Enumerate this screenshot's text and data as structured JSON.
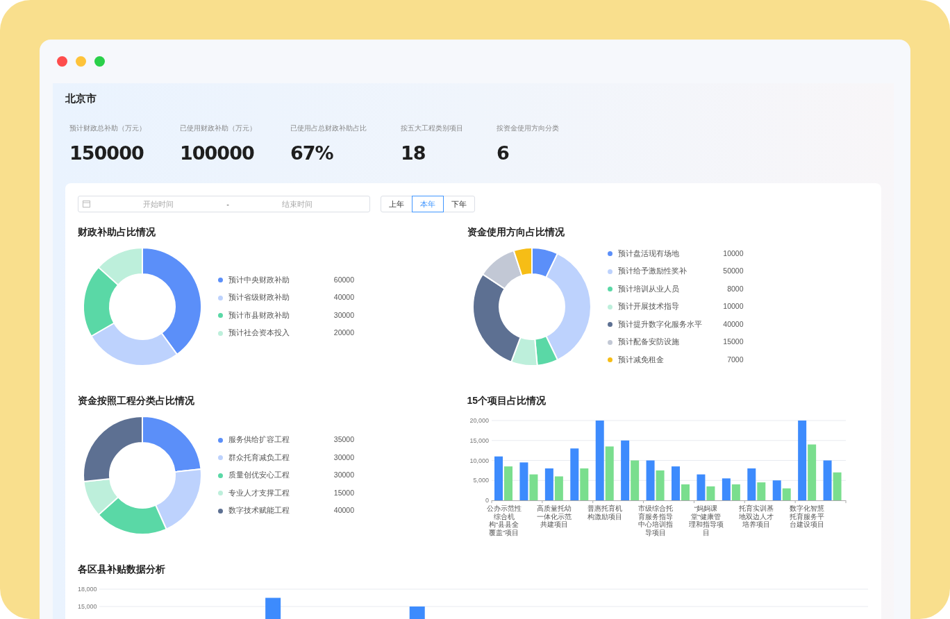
{
  "region": {
    "title": "北京市"
  },
  "stats": [
    {
      "label": "预计财政总补助（万元）",
      "value": "150000"
    },
    {
      "label": "已使用财政补助（万元）",
      "value": "100000"
    },
    {
      "label": "已使用占总财政补助占比",
      "value": "67%"
    },
    {
      "label": "按五大工程类别项目",
      "value": "18"
    },
    {
      "label": "按资金使用方向分类",
      "value": "6"
    }
  ],
  "date_range": {
    "start_placeholder": "开始时间",
    "separator": "-",
    "end_placeholder": "结束时间"
  },
  "year_tabs": [
    {
      "label": "上年",
      "selected": false
    },
    {
      "label": "本年",
      "selected": true
    },
    {
      "label": "下年",
      "selected": false
    }
  ],
  "panels": [
    {
      "title": "财政补助占比情况",
      "legend": [
        {
          "color": "#5b8ff9"
        },
        {
          "color": "#bdd2fd"
        },
        {
          "color": "#5ad8a6"
        },
        {
          "color": "#bdefdb"
        }
      ],
      "chart_data": {
        "type": "donut",
        "legend": "right",
        "value_labels": [
          "60000",
          "40000",
          "30000",
          "20000"
        ],
        "categories": [
          "预计中央财政补助",
          "预计省级财政补助",
          "预计市县财政补助",
          "预计社会资本投入"
        ],
        "values": [
          60000,
          40000,
          30000,
          20000
        ]
      }
    },
    {
      "title": "资金使用方向占比情况",
      "legend": [
        {
          "color": "#5b8ff9"
        },
        {
          "color": "#bdd2fd"
        },
        {
          "color": "#5ad8a6"
        },
        {
          "color": "#bdefdb"
        },
        {
          "color": "#5d7092"
        },
        {
          "color": "#c2c8d5"
        },
        {
          "color": "#f6bd16"
        }
      ],
      "chart_data": {
        "type": "donut",
        "legend": "right",
        "value_labels": [
          "10000",
          "50000",
          "8000",
          "10000",
          "40000",
          "15000",
          "7000"
        ],
        "categories": [
          "预计盘活现有场地",
          "预计给予激励性奖补",
          "预计培训从业人员",
          "预计开展技术指导",
          "预计提升数字化服务水平",
          "预计配备安防设施",
          "预计减免租金"
        ],
        "values": [
          10000,
          50000,
          8000,
          10000,
          40000,
          15000,
          7000
        ]
      }
    },
    {
      "title": "资金按照工程分类占比情况",
      "legend": [
        {
          "color": "#5b8ff9"
        },
        {
          "color": "#bdd2fd"
        },
        {
          "color": "#5ad8a6"
        },
        {
          "color": "#bdefdb"
        },
        {
          "color": "#5d7092"
        }
      ],
      "chart_data": {
        "type": "donut",
        "legend": "right",
        "value_labels": [
          "35000",
          "30000",
          "30000",
          "15000",
          "40000"
        ],
        "categories": [
          "服务供给扩容工程",
          "群众托育减负工程",
          "质量创优安心工程",
          "专业人才支撑工程",
          "数字技术赋能工程"
        ],
        "values": [
          35000,
          30000,
          30000,
          15000,
          40000
        ]
      }
    }
  ],
  "projects": {
    "title": "15个项目占比情况",
    "chart_data": {
      "type": "bar",
      "categories": [
        "公办示范性综合机构“县县全覆盖”项目",
        null,
        "高质量托幼一体化示范共建项目",
        null,
        "普惠托育机构激励项目",
        null,
        "市级综合托育服务指导中心培训指导项目",
        null,
        "“妈妈课堂”健康管理和指导项目",
        null,
        "托育实训基地双边人才培养项目",
        null,
        "数字化智慧托育服务平台建设项目",
        null
      ],
      "series": [
        {
          "color": "#3d8bfd",
          "values": [
            11000,
            9500,
            8000,
            13000,
            20000,
            15000,
            10000,
            8500,
            6500,
            5500,
            8000,
            5000,
            20000,
            10000
          ]
        },
        {
          "color": "#7ade8e",
          "values": [
            8500,
            6500,
            6000,
            8000,
            13500,
            10000,
            7500,
            4000,
            3500,
            4000,
            4500,
            3000,
            14000,
            7000
          ]
        }
      ],
      "ylim": [
        0,
        20000
      ],
      "grid": true,
      "yticks": [
        {
          "value": 0,
          "label": "0"
        },
        {
          "value": 5000,
          "label": "5,000"
        },
        {
          "value": 10000,
          "label": "10,000"
        },
        {
          "value": 15000,
          "label": "15,000"
        },
        {
          "value": 20000,
          "label": "20,000"
        }
      ]
    }
  },
  "districts": {
    "title": "各区县补贴数据分析",
    "chart_data": {
      "type": "bar",
      "series": [
        {
          "color": "#3d8bfd",
          "values": [
            null,
            null,
            null,
            16500,
            null,
            null,
            15000,
            null,
            null,
            null,
            null,
            null,
            null,
            null,
            null,
            null
          ]
        }
      ],
      "grid": true,
      "ylim": [
        0,
        18000
      ],
      "yticks": [
        {
          "value": 15000,
          "label": "15,000"
        },
        {
          "value": 18000,
          "label": "18,000"
        }
      ]
    }
  }
}
